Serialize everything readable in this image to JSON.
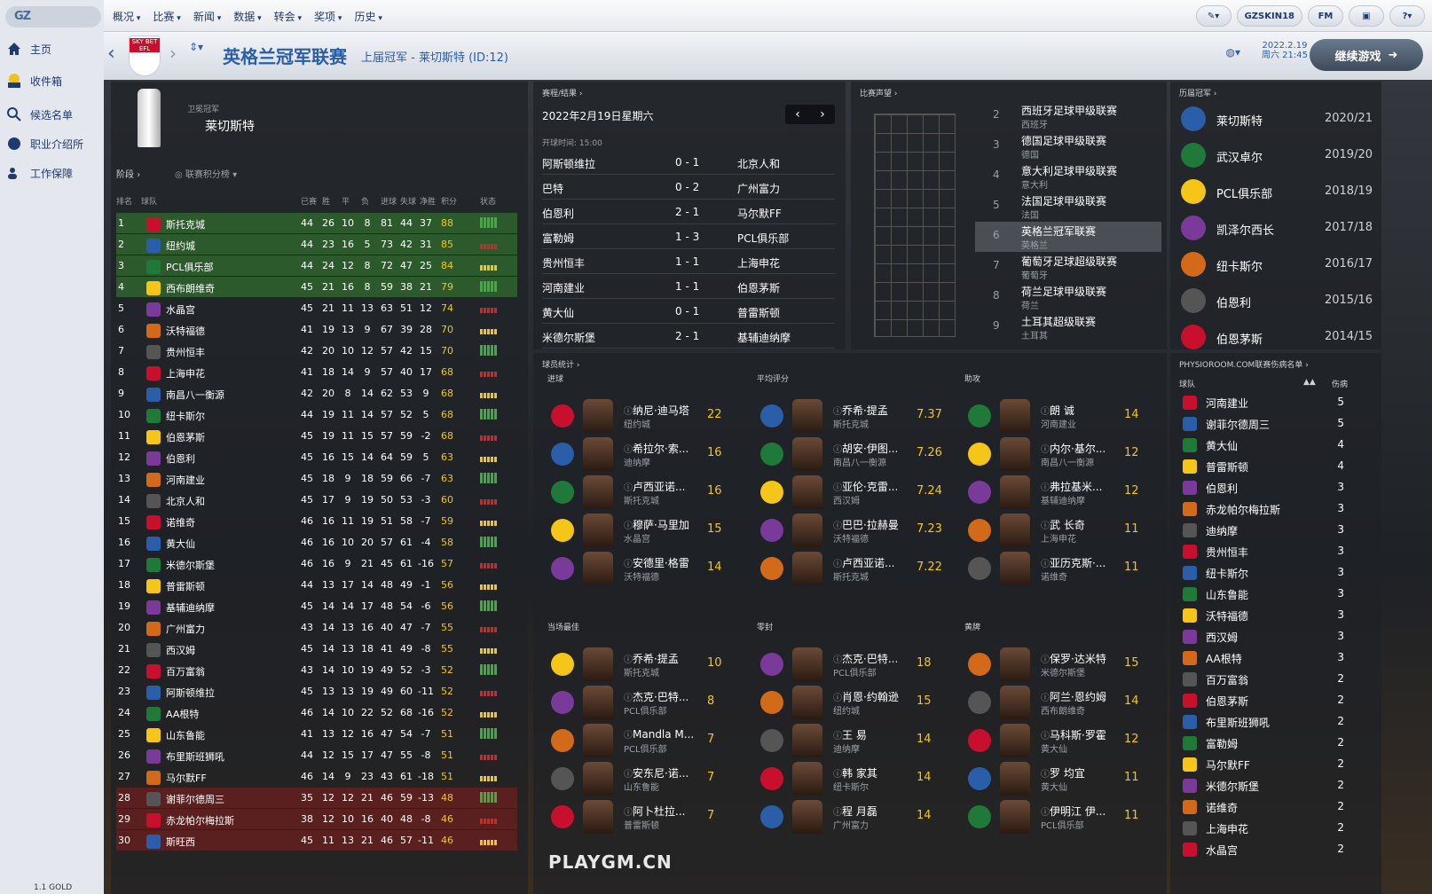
{
  "app": {
    "logo": "GZ",
    "version": "1.1 GOLD",
    "watermark": "PLAYGM.CN"
  },
  "leftnav": [
    {
      "label": "主页",
      "icon": "home-icon"
    },
    {
      "label": "收件箱",
      "icon": "inbox-icon"
    },
    {
      "label": "候选名单",
      "icon": "search-icon"
    },
    {
      "label": "职业介绍所",
      "icon": "globe-icon"
    },
    {
      "label": "工作保障",
      "icon": "people-icon"
    }
  ],
  "menu": [
    "概况",
    "比赛",
    "新闻",
    "数据",
    "转会",
    "奖项",
    "历史"
  ],
  "topright": {
    "user": "GZSKIN18",
    "fm": "FM",
    "help": "?"
  },
  "header": {
    "title": "英格兰冠军联赛",
    "subtitle": "上届冠军 - 莱切斯特 (ID:12)",
    "date": "2022.2.19",
    "day_time": "周六 21:45",
    "continue": "继续游戏",
    "badge": "SKY BET EFL"
  },
  "standings": {
    "title_label": "卫冕冠军",
    "champion": "莱切斯特",
    "stage": "阶段",
    "table_label": "联赛积分榜",
    "headers": [
      "排名",
      "球队",
      "已赛",
      "胜",
      "平",
      "负",
      "进球",
      "失球",
      "净胜",
      "积分",
      "状态"
    ],
    "rows": [
      [
        "1",
        "斯托克城",
        "44",
        "26",
        "10",
        "8",
        "81",
        "44",
        "37",
        "88"
      ],
      [
        "2",
        "纽约城",
        "44",
        "23",
        "16",
        "5",
        "73",
        "42",
        "31",
        "85"
      ],
      [
        "3",
        "PCL俱乐部",
        "44",
        "24",
        "12",
        "8",
        "72",
        "47",
        "25",
        "84"
      ],
      [
        "4",
        "西布朗维奇",
        "45",
        "21",
        "16",
        "8",
        "59",
        "38",
        "21",
        "79"
      ],
      [
        "5",
        "水晶宫",
        "45",
        "21",
        "11",
        "13",
        "63",
        "51",
        "12",
        "74"
      ],
      [
        "6",
        "沃特福德",
        "41",
        "19",
        "13",
        "9",
        "67",
        "39",
        "28",
        "70"
      ],
      [
        "7",
        "贵州恒丰",
        "42",
        "20",
        "10",
        "12",
        "57",
        "42",
        "15",
        "70"
      ],
      [
        "8",
        "上海申花",
        "41",
        "18",
        "14",
        "9",
        "57",
        "40",
        "17",
        "68"
      ],
      [
        "9",
        "南昌八一衡源",
        "42",
        "20",
        "8",
        "14",
        "62",
        "53",
        "9",
        "68"
      ],
      [
        "10",
        "纽卡斯尔",
        "44",
        "19",
        "11",
        "14",
        "57",
        "52",
        "5",
        "68"
      ],
      [
        "11",
        "伯恩茅斯",
        "45",
        "19",
        "11",
        "15",
        "57",
        "59",
        "-2",
        "68"
      ],
      [
        "12",
        "伯恩利",
        "45",
        "16",
        "15",
        "14",
        "64",
        "59",
        "5",
        "63"
      ],
      [
        "13",
        "河南建业",
        "45",
        "18",
        "9",
        "18",
        "59",
        "66",
        "-7",
        "63"
      ],
      [
        "14",
        "北京人和",
        "45",
        "17",
        "9",
        "19",
        "50",
        "53",
        "-3",
        "60"
      ],
      [
        "15",
        "诺维奇",
        "46",
        "16",
        "11",
        "19",
        "51",
        "58",
        "-7",
        "59"
      ],
      [
        "16",
        "黄大仙",
        "46",
        "16",
        "10",
        "20",
        "57",
        "61",
        "-4",
        "58"
      ],
      [
        "17",
        "米德尔斯堡",
        "46",
        "16",
        "9",
        "21",
        "45",
        "61",
        "-16",
        "57"
      ],
      [
        "18",
        "普雷斯顿",
        "44",
        "13",
        "17",
        "14",
        "48",
        "49",
        "-1",
        "56"
      ],
      [
        "19",
        "基辅迪纳摩",
        "45",
        "14",
        "14",
        "17",
        "48",
        "54",
        "-6",
        "56"
      ],
      [
        "20",
        "广州富力",
        "43",
        "14",
        "13",
        "16",
        "40",
        "47",
        "-7",
        "55"
      ],
      [
        "21",
        "西汉姆",
        "45",
        "14",
        "13",
        "18",
        "41",
        "49",
        "-8",
        "55"
      ],
      [
        "22",
        "百万富翁",
        "43",
        "14",
        "10",
        "19",
        "49",
        "52",
        "-3",
        "52"
      ],
      [
        "23",
        "阿斯顿维拉",
        "45",
        "13",
        "13",
        "19",
        "49",
        "60",
        "-11",
        "52"
      ],
      [
        "24",
        "AA根特",
        "46",
        "14",
        "10",
        "22",
        "52",
        "68",
        "-16",
        "52"
      ],
      [
        "25",
        "山东鲁能",
        "41",
        "13",
        "12",
        "16",
        "47",
        "54",
        "-7",
        "51"
      ],
      [
        "26",
        "布里斯班狮吼",
        "44",
        "12",
        "15",
        "17",
        "47",
        "55",
        "-8",
        "51"
      ],
      [
        "27",
        "马尔默FF",
        "46",
        "14",
        "9",
        "23",
        "43",
        "61",
        "-18",
        "51"
      ],
      [
        "28",
        "谢菲尔德周三",
        "35",
        "12",
        "12",
        "21",
        "46",
        "59",
        "-13",
        "48"
      ],
      [
        "29",
        "赤龙帕尔梅拉斯",
        "38",
        "12",
        "10",
        "16",
        "40",
        "48",
        "-8",
        "46"
      ],
      [
        "30",
        "斯旺西",
        "45",
        "11",
        "13",
        "21",
        "46",
        "57",
        "-11",
        "46"
      ]
    ]
  },
  "fixtures": {
    "title": "赛程/结果",
    "date": "2022年2月19日星期六",
    "kickoff": "开球时间: 15:00",
    "matches": [
      [
        "阿斯顿维拉",
        "0 - 1",
        "北京人和"
      ],
      [
        "巴特",
        "0 - 2",
        "广州富力"
      ],
      [
        "伯恩利",
        "2 - 1",
        "马尔默FF"
      ],
      [
        "富勒姆",
        "1 - 3",
        "PCL俱乐部"
      ],
      [
        "贵州恒丰",
        "1 - 1",
        "上海申花"
      ],
      [
        "河南建业",
        "1 - 1",
        "伯恩茅斯"
      ],
      [
        "黄大仙",
        "0 - 1",
        "普雷斯顿"
      ],
      [
        "米德尔斯堡",
        "2 - 1",
        "基辅迪纳摩"
      ]
    ]
  },
  "reputation": {
    "title": "比赛声望",
    "leagues": [
      [
        "2",
        "西班牙足球甲级联赛",
        "西班牙"
      ],
      [
        "3",
        "德国足球甲级联赛",
        "德国"
      ],
      [
        "4",
        "意大利足球甲级联赛",
        "意大利"
      ],
      [
        "5",
        "法国足球甲级联赛",
        "法国"
      ],
      [
        "6",
        "英格兰冠军联赛",
        "英格兰"
      ],
      [
        "7",
        "葡萄牙足球超级联赛",
        "葡萄牙"
      ],
      [
        "8",
        "荷兰足球甲级联赛",
        "荷兰"
      ],
      [
        "9",
        "土耳其超级联赛",
        "土耳其"
      ]
    ]
  },
  "champions": {
    "title": "历届冠军",
    "rows": [
      [
        "莱切斯特",
        "2020/21"
      ],
      [
        "武汉卓尔",
        "2019/20"
      ],
      [
        "PCL俱乐部",
        "2018/19"
      ],
      [
        "凯泽尔西长",
        "2017/18"
      ],
      [
        "纽卡斯尔",
        "2016/17"
      ],
      [
        "伯恩利",
        "2015/16"
      ],
      [
        "伯恩茅斯",
        "2014/15"
      ]
    ]
  },
  "stats": {
    "title": "球员统计",
    "groups": [
      {
        "label": "进球",
        "players": [
          [
            "纳尼·迪马塔",
            "纽约城",
            "22"
          ],
          [
            "希拉尔·索...",
            "迪纳摩",
            "16"
          ],
          [
            "卢西亚诺...",
            "斯托克城",
            "16"
          ],
          [
            "穆萨·马里加",
            "水晶宫",
            "15"
          ],
          [
            "安德里·格雷",
            "沃特福德",
            "14"
          ]
        ]
      },
      {
        "label": "平均评分",
        "players": [
          [
            "乔希·提孟",
            "斯托克城",
            "7.37"
          ],
          [
            "胡安·伊图...",
            "南昌八一衡源",
            "7.26"
          ],
          [
            "亚伦·克雷...",
            "西汉姆",
            "7.24"
          ],
          [
            "巴巴·拉赫曼",
            "沃特福德",
            "7.23"
          ],
          [
            "卢西亚诺...",
            "斯托克城",
            "7.22"
          ]
        ]
      },
      {
        "label": "助攻",
        "players": [
          [
            "朗 诚",
            "河南建业",
            "14"
          ],
          [
            "内尔·基尔...",
            "南昌八一衡源",
            "12"
          ],
          [
            "弗拉基米...",
            "基辅迪纳摩",
            "12"
          ],
          [
            "武 长奇",
            "上海申花",
            "11"
          ],
          [
            "亚历克斯·...",
            "诺维奇",
            "11"
          ]
        ]
      },
      {
        "label": "当场最佳",
        "players": [
          [
            "乔希·提孟",
            "斯托克城",
            "10"
          ],
          [
            "杰克·巴特...",
            "PCL俱乐部",
            "8"
          ],
          [
            "Mandla M...",
            "PCL俱乐部",
            "7"
          ],
          [
            "安东尼·诺...",
            "山东鲁能",
            "7"
          ],
          [
            "阿卜杜拉...",
            "普雷斯顿",
            "7"
          ]
        ]
      },
      {
        "label": "零封",
        "players": [
          [
            "杰克·巴特...",
            "PCL俱乐部",
            "18"
          ],
          [
            "肖恩·约翰逊",
            "纽约城",
            "15"
          ],
          [
            "王 易",
            "迪纳摩",
            "14"
          ],
          [
            "韩 家其",
            "纽卡斯尔",
            "14"
          ],
          [
            "程 月磊",
            "广州富力",
            "14"
          ]
        ]
      },
      {
        "label": "黄牌",
        "players": [
          [
            "保罗·达米特",
            "米德尔斯堡",
            "15"
          ],
          [
            "阿兰·恩约姆",
            "西布朗维奇",
            "14"
          ],
          [
            "马科斯·罗霍",
            "黄大仙",
            "12"
          ],
          [
            "罗 均宜",
            "黄大仙",
            "11"
          ],
          [
            "伊明江 伊...",
            "PCL俱乐部",
            "11"
          ]
        ]
      }
    ]
  },
  "injuries": {
    "title": "PHYSIOROOM.COM联赛伤病名单",
    "col_team": "球队",
    "col_inj": "伤病",
    "rows": [
      [
        "河南建业",
        "5"
      ],
      [
        "谢菲尔德周三",
        "5"
      ],
      [
        "黄大仙",
        "4"
      ],
      [
        "普雷斯顿",
        "4"
      ],
      [
        "伯恩利",
        "3"
      ],
      [
        "赤龙帕尔梅拉斯",
        "3"
      ],
      [
        "迪纳摩",
        "3"
      ],
      [
        "贵州恒丰",
        "3"
      ],
      [
        "纽卡斯尔",
        "3"
      ],
      [
        "山东鲁能",
        "3"
      ],
      [
        "沃特福德",
        "3"
      ],
      [
        "西汉姆",
        "3"
      ],
      [
        "AA根特",
        "3"
      ],
      [
        "百万富翁",
        "2"
      ],
      [
        "伯恩茅斯",
        "2"
      ],
      [
        "布里斯班狮吼",
        "2"
      ],
      [
        "富勒姆",
        "2"
      ],
      [
        "马尔默FF",
        "2"
      ],
      [
        "米德尔斯堡",
        "2"
      ],
      [
        "诺维奇",
        "2"
      ],
      [
        "上海申花",
        "2"
      ],
      [
        "水晶宫",
        "2"
      ]
    ]
  },
  "colors": {
    "accent": "#2a5ea8",
    "promo": "#2d5a2d",
    "releg": "#5a1f1f",
    "points": "#f5c518"
  }
}
